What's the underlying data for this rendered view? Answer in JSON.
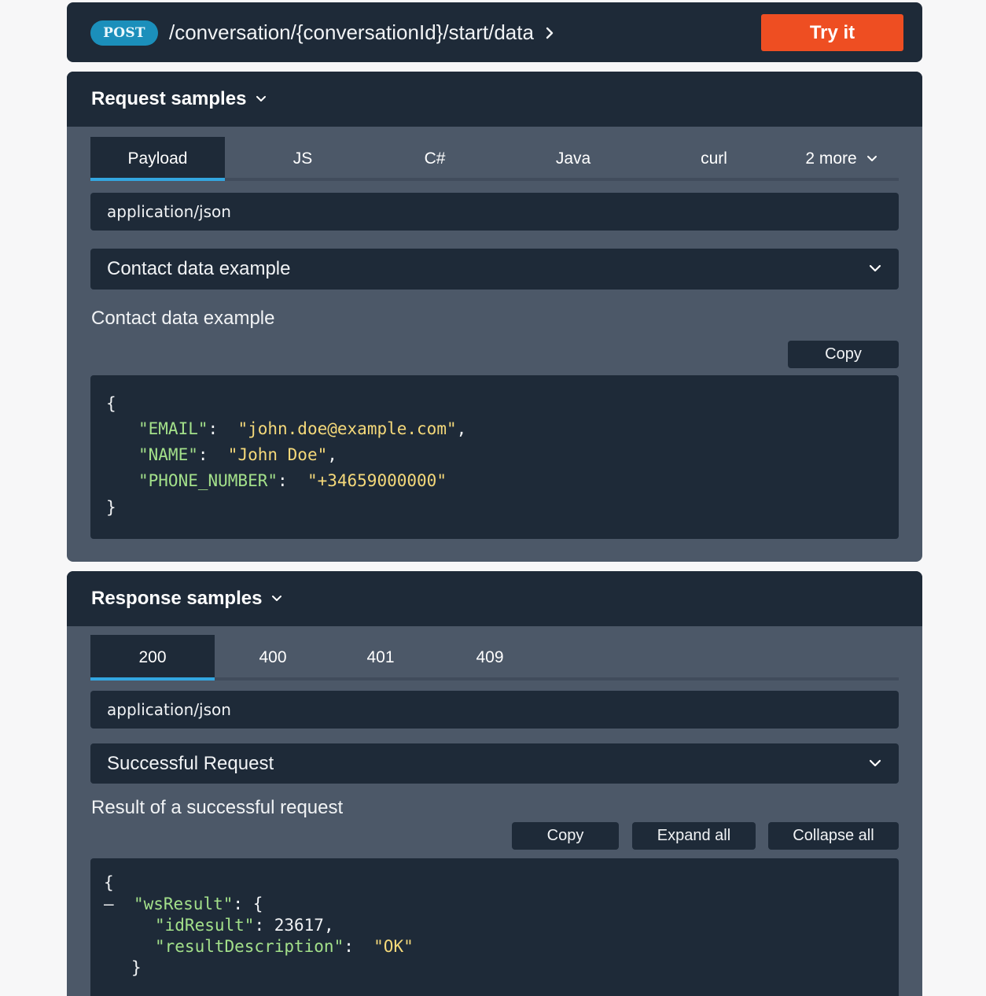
{
  "endpoint": {
    "method": "POST",
    "path": "/conversation/{conversationId}/start/data",
    "try_label": "Try it"
  },
  "request": {
    "title": "Request samples",
    "tabs": [
      "Payload",
      "JS",
      "C#",
      "Java",
      "curl",
      "2 more"
    ],
    "active_tab": "Payload",
    "content_type": "application/json",
    "example_selected": "Contact data example",
    "example_description": "Contact data example",
    "copy_label": "Copy",
    "code": {
      "open": "{",
      "close": "}",
      "fields": [
        {
          "key": "\"EMAIL\"",
          "value": "\"john.doe@example.com\""
        },
        {
          "key": "\"NAME\"",
          "value": "\"John Doe\""
        },
        {
          "key": "\"PHONE_NUMBER\"",
          "value": "\"+34659000000\""
        }
      ]
    }
  },
  "response": {
    "title": "Response samples",
    "tabs": [
      "200",
      "400",
      "401",
      "409"
    ],
    "active_tab": "200",
    "content_type": "application/json",
    "example_selected": "Successful Request",
    "example_description": "Result of a successful request",
    "copy_label": "Copy",
    "expand_label": "Expand all",
    "collapse_label": "Collapse all",
    "code": {
      "open": "{",
      "collapse_marker": "–",
      "object_key": "\"wsResult\"",
      "object_open": "{",
      "object_close": "}",
      "fields": [
        {
          "key": "\"idResult\"",
          "value": "23617"
        },
        {
          "key": "\"resultDescription\"",
          "value": "\"OK\""
        }
      ]
    }
  },
  "colors": {
    "accent_orange": "#ee4e22",
    "method_blue": "#1b8fbb",
    "tab_underline": "#33a6e0",
    "json_key": "#a3e08a",
    "json_string": "#f5d97a"
  }
}
